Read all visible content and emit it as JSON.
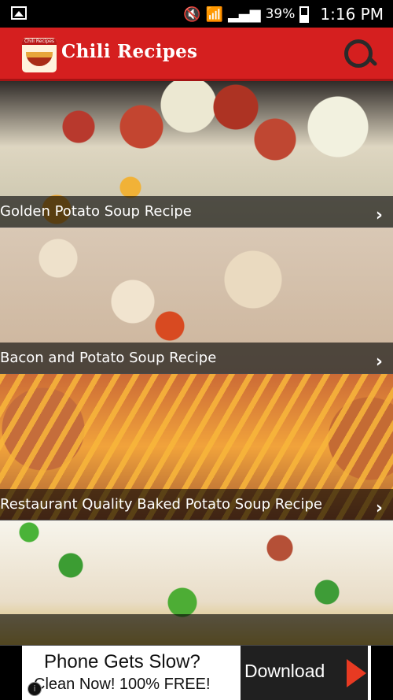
{
  "status_bar": {
    "battery_percent": "39%",
    "time": "1:16 PM",
    "icons": [
      "image-icon",
      "mute-icon",
      "wifi-icon",
      "signal-icon",
      "battery-icon"
    ]
  },
  "app_bar": {
    "logo_text": "Chili Recipes",
    "title": "Chili Recipes",
    "icon": "search-icon"
  },
  "recipes": [
    {
      "title": "Golden Potato Soup Recipe"
    },
    {
      "title": "Bacon and Potato Soup Recipe"
    },
    {
      "title": "Restaurant Quality Baked Potato Soup Recipe"
    },
    {
      "title": ""
    }
  ],
  "ad": {
    "line1": "Phone Gets Slow?",
    "line2": "Clean Now! 100% FREE!",
    "button_label": "Download",
    "icon": "arrow-icon"
  },
  "colors": {
    "app_bar": "#d51f1f",
    "caption_overlay": "#000000",
    "ad_arrow": "#e83a22"
  }
}
